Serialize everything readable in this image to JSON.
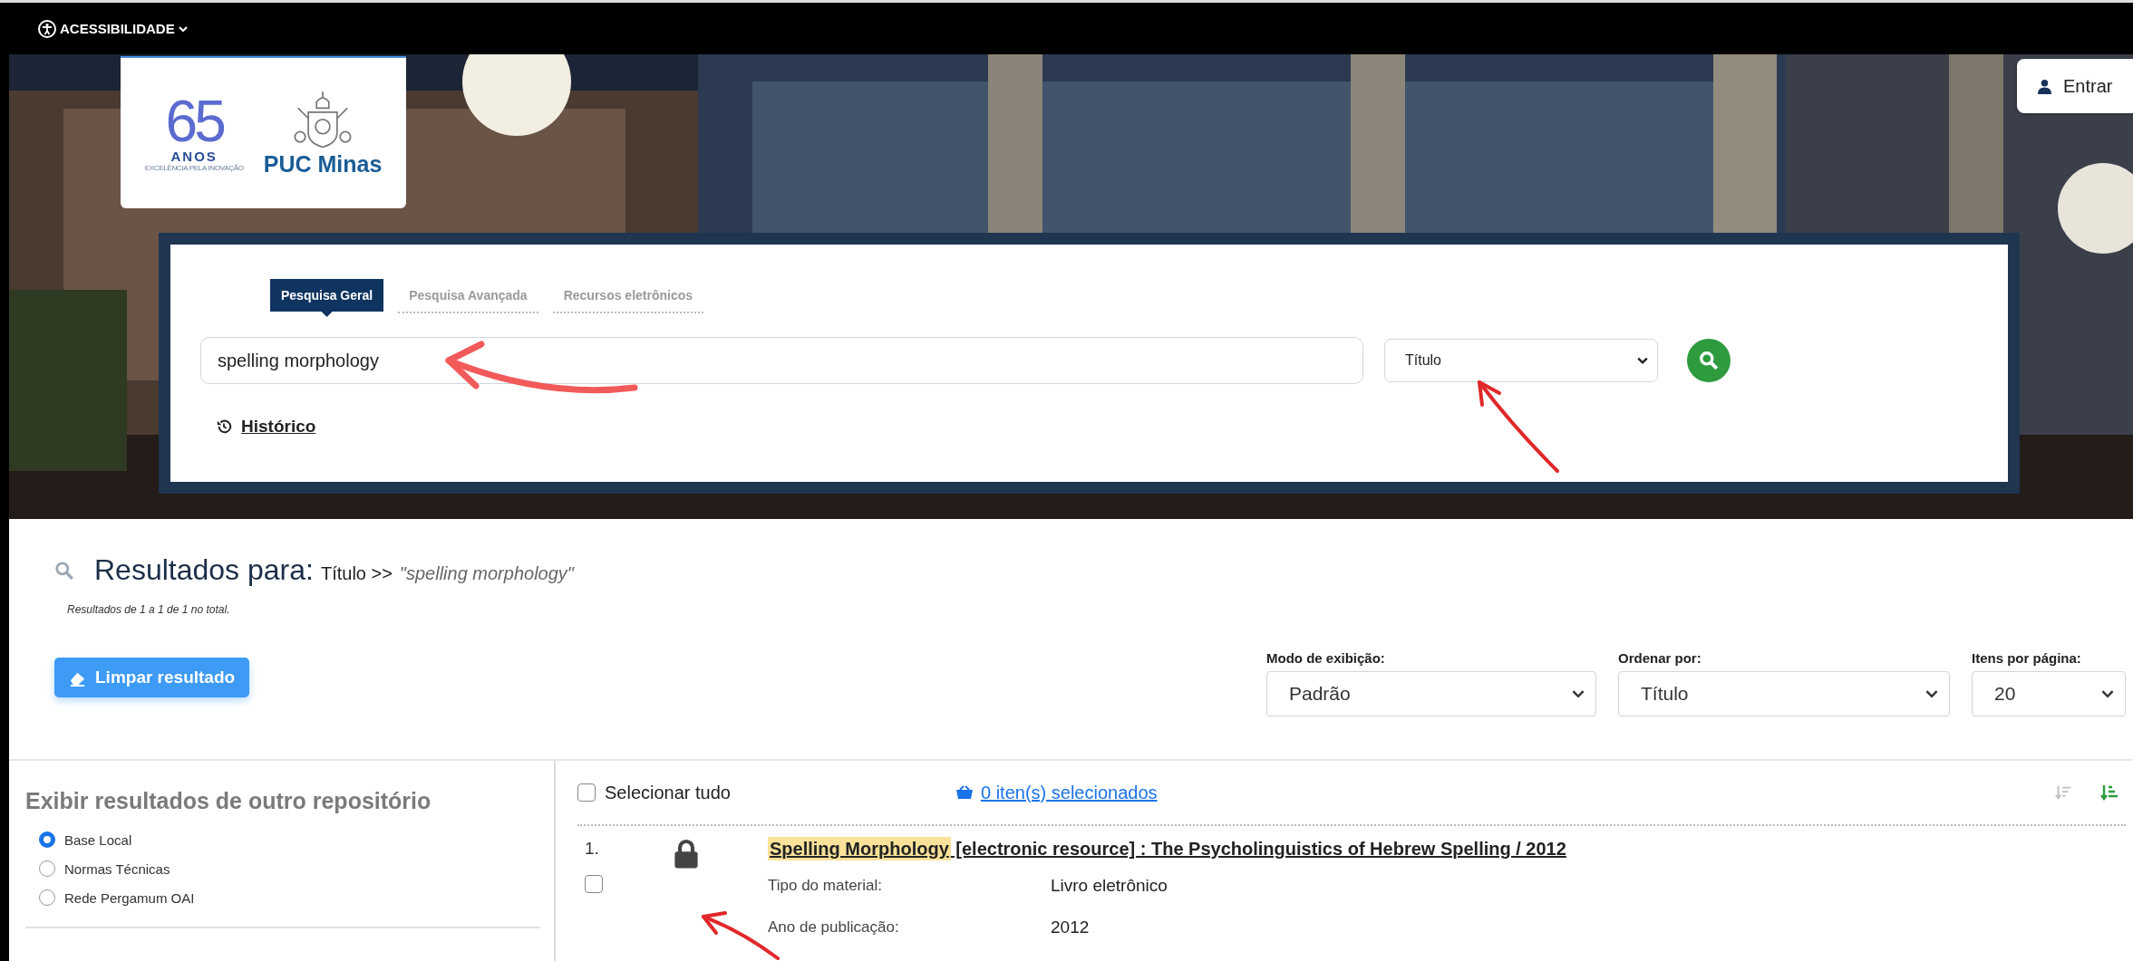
{
  "top_bar": {
    "accessibility_label": "ACESSIBILIDADE"
  },
  "header": {
    "logo": {
      "number": "65",
      "word": "ANOS",
      "tagline": "EXCELÊNCIA PELA INOVAÇÃO",
      "brand": "PUC Minas"
    },
    "login_button": "Entrar"
  },
  "search": {
    "tabs": [
      {
        "label": "Pesquisa Geral",
        "selected": true
      },
      {
        "label": "Pesquisa Avançada",
        "selected": false
      },
      {
        "label": "Recursos eletrônicos",
        "selected": false
      }
    ],
    "query": "spelling morphology",
    "field": "Título",
    "history_link": "Histórico"
  },
  "results": {
    "heading": "Resultados para:",
    "field": "Título",
    "separator": ">>",
    "query": "\"spelling morphology\"",
    "summary": "Resultados de 1 a 1 de 1 no total.",
    "clear_button": "Limpar resultado"
  },
  "controls": [
    {
      "label": "Modo de exibição:",
      "value": "Padrão"
    },
    {
      "label": "Ordenar por:",
      "value": "Título"
    },
    {
      "label": "Itens por página:",
      "value": "20"
    }
  ],
  "sidebar": {
    "title": "Exibir resultados de outro repositório",
    "repositories": [
      {
        "label": "Base Local",
        "selected": true
      },
      {
        "label": "Normas Técnicas",
        "selected": false
      },
      {
        "label": "Rede Pergamum OAI",
        "selected": false
      }
    ]
  },
  "list": {
    "select_all": {
      "label": "Selecionar tudo",
      "checked": false
    },
    "basket_link": "0 iten(s) selecionados",
    "sort_buttons": [
      {
        "kind": "descending",
        "selected": false
      },
      {
        "kind": "ascending",
        "selected": true
      }
    ],
    "records": [
      {
        "number": "1.",
        "locked": true,
        "checked": false,
        "title_highlight": "Spelling Morphology",
        "title_rest": "[electronic resource] : The Psycholinguistics of Hebrew Spelling / 2012",
        "fields": [
          {
            "label": "Tipo do material:",
            "value": "Livro eletrônico"
          },
          {
            "label": "Ano de publicação:",
            "value": "2012"
          }
        ]
      }
    ]
  }
}
